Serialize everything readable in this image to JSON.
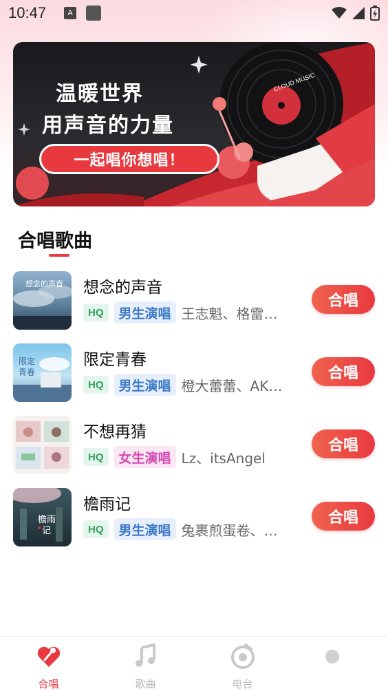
{
  "status_bar": {
    "time": "10:47",
    "notification_letter": "A"
  },
  "banner": {
    "line1": "温暖世界",
    "line2": "用声音的力量",
    "pill": "一起唱你想唱！",
    "record_label": "CLOUD MUSIC"
  },
  "section": {
    "title": "合唱歌曲"
  },
  "songs": [
    {
      "title": "想念的声音",
      "hq": "HQ",
      "voice": "男生演唱",
      "voice_type": "male",
      "artists": "王志魁、格雷西西西",
      "button": "合唱"
    },
    {
      "title": "限定青春",
      "hq": "HQ",
      "voice": "男生演唱",
      "voice_type": "male",
      "artists": "橙大蕾蕾、AK刘彰",
      "button": "合唱"
    },
    {
      "title": "不想再猜",
      "hq": "HQ",
      "voice": "女生演唱",
      "voice_type": "female",
      "artists": "Lz、itsAngel",
      "button": "合唱"
    },
    {
      "title": "檐雨记",
      "hq": "HQ",
      "voice": "男生演唱",
      "voice_type": "male",
      "artists": "兔裹煎蛋卷、洛少爷",
      "button": "合唱"
    }
  ],
  "nav": {
    "items": [
      {
        "label": "合唱",
        "icon": "chorus-icon",
        "active": true
      },
      {
        "label": "歌曲",
        "icon": "music-note-icon",
        "active": false
      },
      {
        "label": "电台",
        "icon": "radio-icon",
        "active": false
      },
      {
        "label": "",
        "icon": "profile-dot-icon",
        "active": false
      }
    ]
  },
  "colors": {
    "accent": "#e8393f",
    "hq_green": "#2fa05c",
    "male_blue": "#3c79c8",
    "female_pink": "#d448b4"
  }
}
